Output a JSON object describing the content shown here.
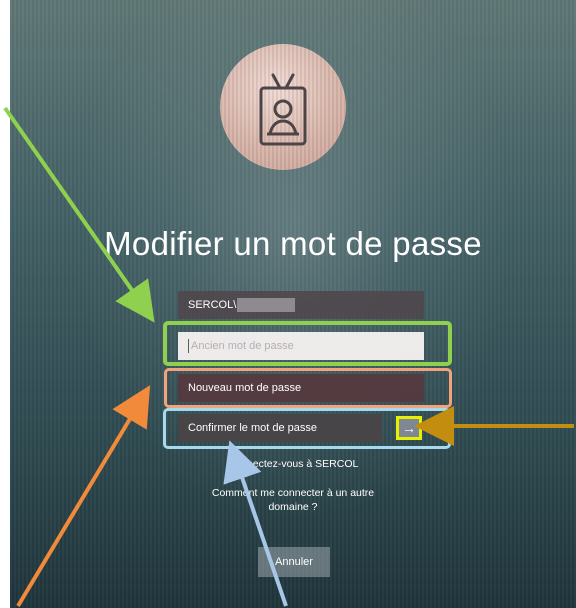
{
  "title": "Modifier un mot de passe",
  "fields": {
    "username_prefix": "SERCOL\\",
    "old_password_placeholder": "Ancien mot de passe",
    "new_password_placeholder": "Nouveau mot de passe",
    "confirm_password_placeholder": "Confirmer le mot de passe"
  },
  "links": {
    "connect_sercol": "Connectez-vous à SERCOL",
    "other_domain_line1": "Comment me connecter à un autre",
    "other_domain_line2": "domaine ?"
  },
  "buttons": {
    "submit_icon": "→",
    "cancel": "Annuler"
  },
  "icons": {
    "avatar": "badge-icon",
    "submit": "arrow-right-icon"
  },
  "colors": {
    "green_annotation": "#8fd14f",
    "orange_annotation": "#f3a37c",
    "blue_annotation": "#a8d8eb",
    "yellow_annotation": "#e6f000"
  }
}
